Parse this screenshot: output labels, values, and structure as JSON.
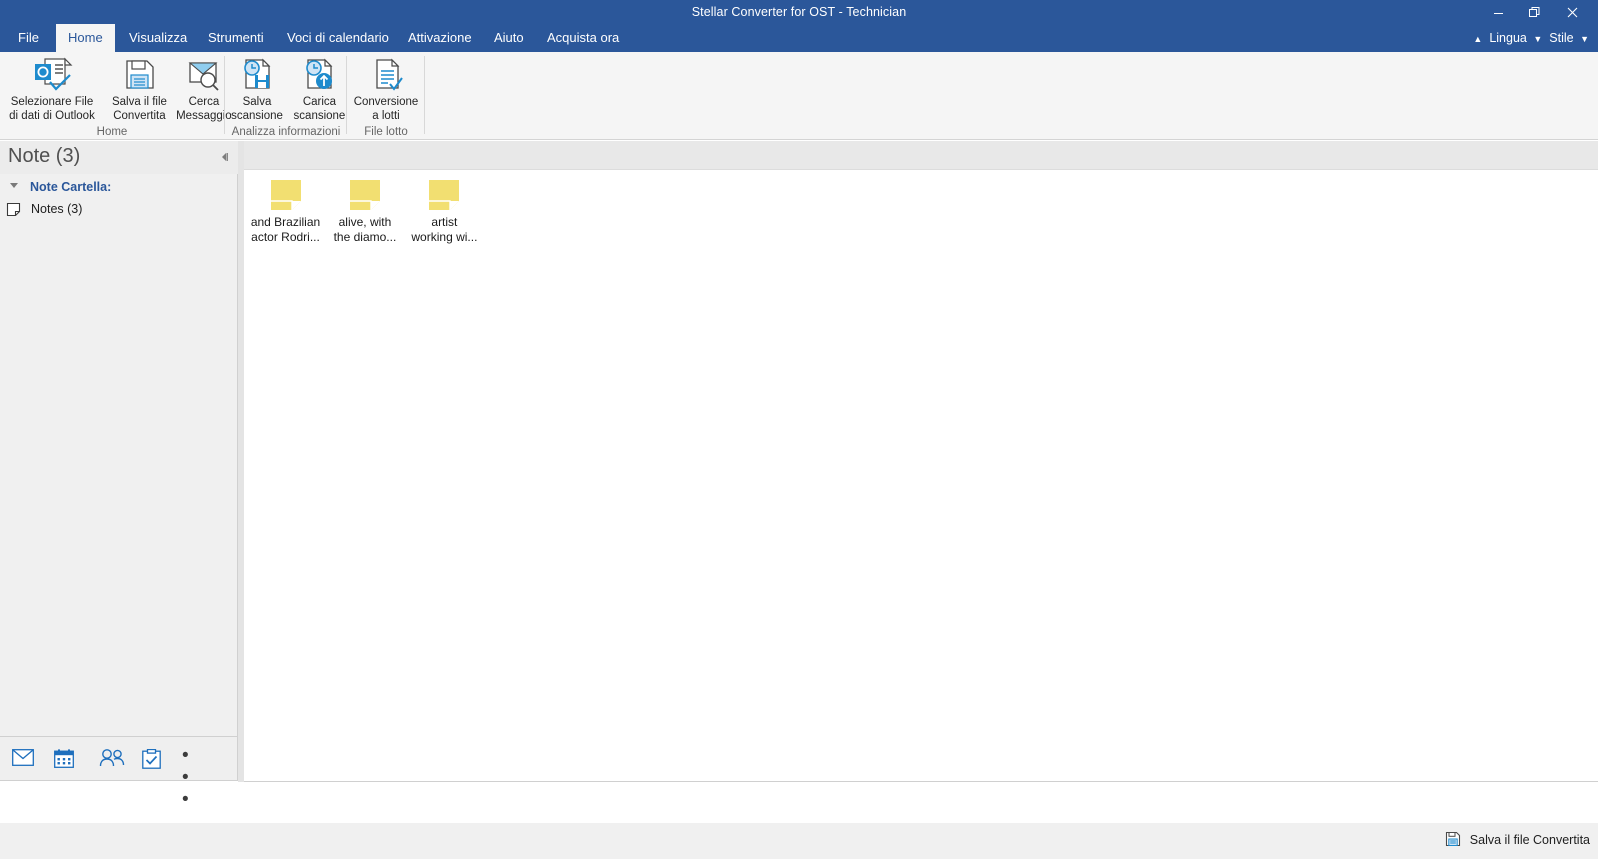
{
  "window": {
    "title": "Stellar Converter for OST - Technician",
    "titlebar_color": "#2b579a",
    "controls": {
      "minimize": "minimize-button",
      "maximize": "restore-button",
      "close": "close-button"
    }
  },
  "ribbon": {
    "tabs": [
      {
        "label": "File",
        "active": false
      },
      {
        "label": "Home",
        "active": true
      },
      {
        "label": "Visualizza",
        "active": false
      },
      {
        "label": "Strumenti",
        "active": false
      },
      {
        "label": "Voci di calendario",
        "active": false
      },
      {
        "label": "Attivazione",
        "active": false
      },
      {
        "label": "Aiuto",
        "active": false
      },
      {
        "label": "Acquista ora",
        "active": false
      }
    ],
    "right_items": [
      {
        "label": "Lingua",
        "icon": "chevron-up-icon"
      },
      {
        "label": "Stile",
        "icon": "chevron-down-icon"
      }
    ],
    "groups": [
      {
        "caption": "Home",
        "buttons": [
          {
            "label": "Selezionare File\ndi dati di Outlook",
            "icon": "outlook-data-file-icon"
          },
          {
            "label": "Salva il file\nConvertita",
            "icon": "save-floppy-icon"
          },
          {
            "label": "Cerca\nMessaggio",
            "icon": "search-message-icon"
          }
        ]
      },
      {
        "caption": "Analizza informazioni",
        "buttons": [
          {
            "label": "Salva\nscansione",
            "icon": "save-scan-icon"
          },
          {
            "label": "Carica\nscansione",
            "icon": "load-scan-icon"
          }
        ]
      },
      {
        "caption": "File lotto",
        "buttons": [
          {
            "label": "Conversione\na lotti",
            "icon": "batch-conversion-icon"
          }
        ]
      }
    ]
  },
  "sidebar": {
    "title": "Note (3)",
    "collapse_icon": "collapse-left-icon",
    "tree": {
      "root_label": "Note Cartella:",
      "items": [
        {
          "label": "Notes (3)",
          "icon": "note-page-icon"
        }
      ]
    },
    "nav": [
      {
        "name": "mail",
        "icon": "mail-icon"
      },
      {
        "name": "calendar",
        "icon": "calendar-icon"
      },
      {
        "name": "people",
        "icon": "people-icon"
      },
      {
        "name": "tasks",
        "icon": "tasks-icon"
      },
      {
        "name": "more",
        "icon": "ellipsis-icon",
        "glyph": "• • •"
      }
    ]
  },
  "content": {
    "notes": [
      {
        "label": "and Brazilian\nactor Rodri...",
        "icon": "sticky-note-icon",
        "color": "#f2df71"
      },
      {
        "label": "alive, with\nthe diamo...",
        "icon": "sticky-note-icon",
        "color": "#f2df71"
      },
      {
        "label": "artist\nworking wi...",
        "icon": "sticky-note-icon",
        "color": "#f2df71"
      }
    ]
  },
  "statusbar": {
    "action_label": "Salva il file Convertita",
    "action_icon": "save-floppy-icon"
  },
  "colors": {
    "accent": "#2b579a",
    "ribbon_bg": "#f5f5f5",
    "sidebar_bg": "#f0f0f0",
    "note_yellow": "#f2df71",
    "icon_blue": "#1e8bcd"
  }
}
